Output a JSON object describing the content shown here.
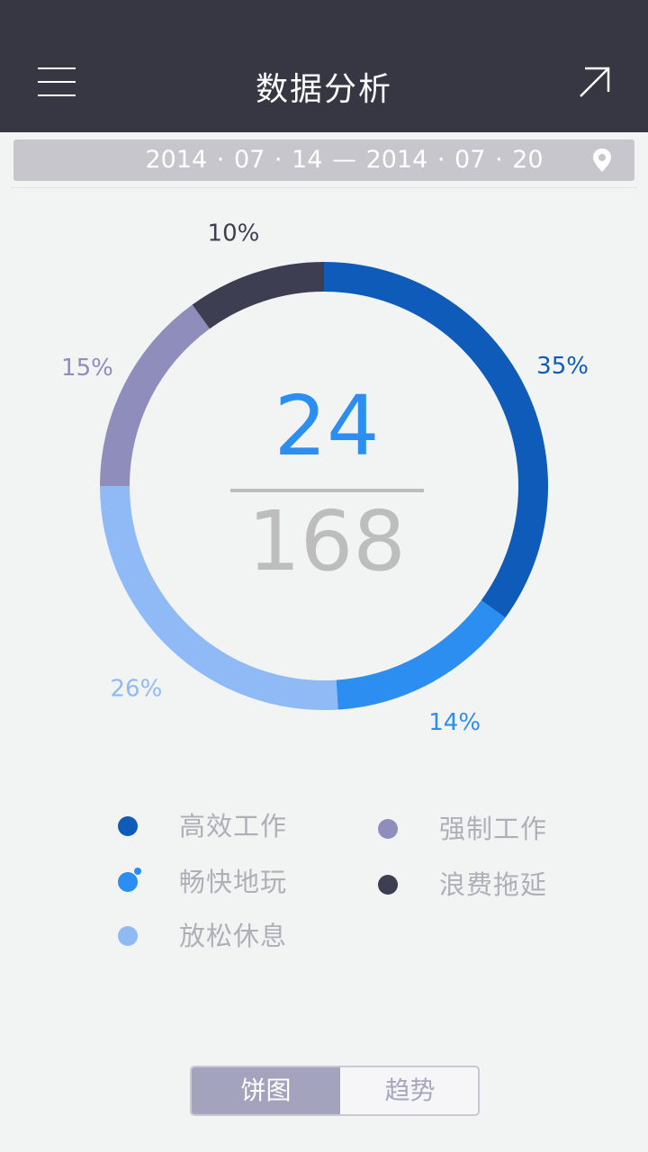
{
  "header": {
    "title": "数据分析",
    "menu_icon": "hamburger-menu-icon",
    "share_icon": "arrow-up-right-icon"
  },
  "date_bar": {
    "range": "2014 · 07 · 14   —   2014 · 07 · 20",
    "location_icon": "location-pin-icon"
  },
  "summary": {
    "value": "24",
    "total": "168"
  },
  "chart_data": {
    "type": "pie",
    "variant": "donut",
    "start": "12 o'clock, clockwise",
    "slices": [
      {
        "label": "高效工作",
        "percent": 35,
        "value_label": "35%",
        "color": "#0e5bb9"
      },
      {
        "label": "畅快地玩",
        "percent": 14,
        "value_label": "14%",
        "color": "#2b8ef0"
      },
      {
        "label": "放松休息",
        "percent": 26,
        "value_label": "26%",
        "color": "#8fbaf6"
      },
      {
        "label": "强制工作",
        "percent": 15,
        "value_label": "15%",
        "color": "#8f8dbb"
      },
      {
        "label": "浪费拖延",
        "percent": 10,
        "value_label": "10%",
        "color": "#3d3e52"
      }
    ]
  },
  "legend": {
    "items": [
      {
        "label": "高效工作",
        "color": "#0e5bb9"
      },
      {
        "label": "畅快地玩",
        "color": "#2b8ef0"
      },
      {
        "label": "放松休息",
        "color": "#8fbaf6"
      },
      {
        "label": "强制工作",
        "color": "#8f8dbb"
      },
      {
        "label": "浪费拖延",
        "color": "#3d3e52"
      }
    ]
  },
  "tabs": {
    "pie": "饼图",
    "trend": "趋势",
    "active": "pie"
  }
}
